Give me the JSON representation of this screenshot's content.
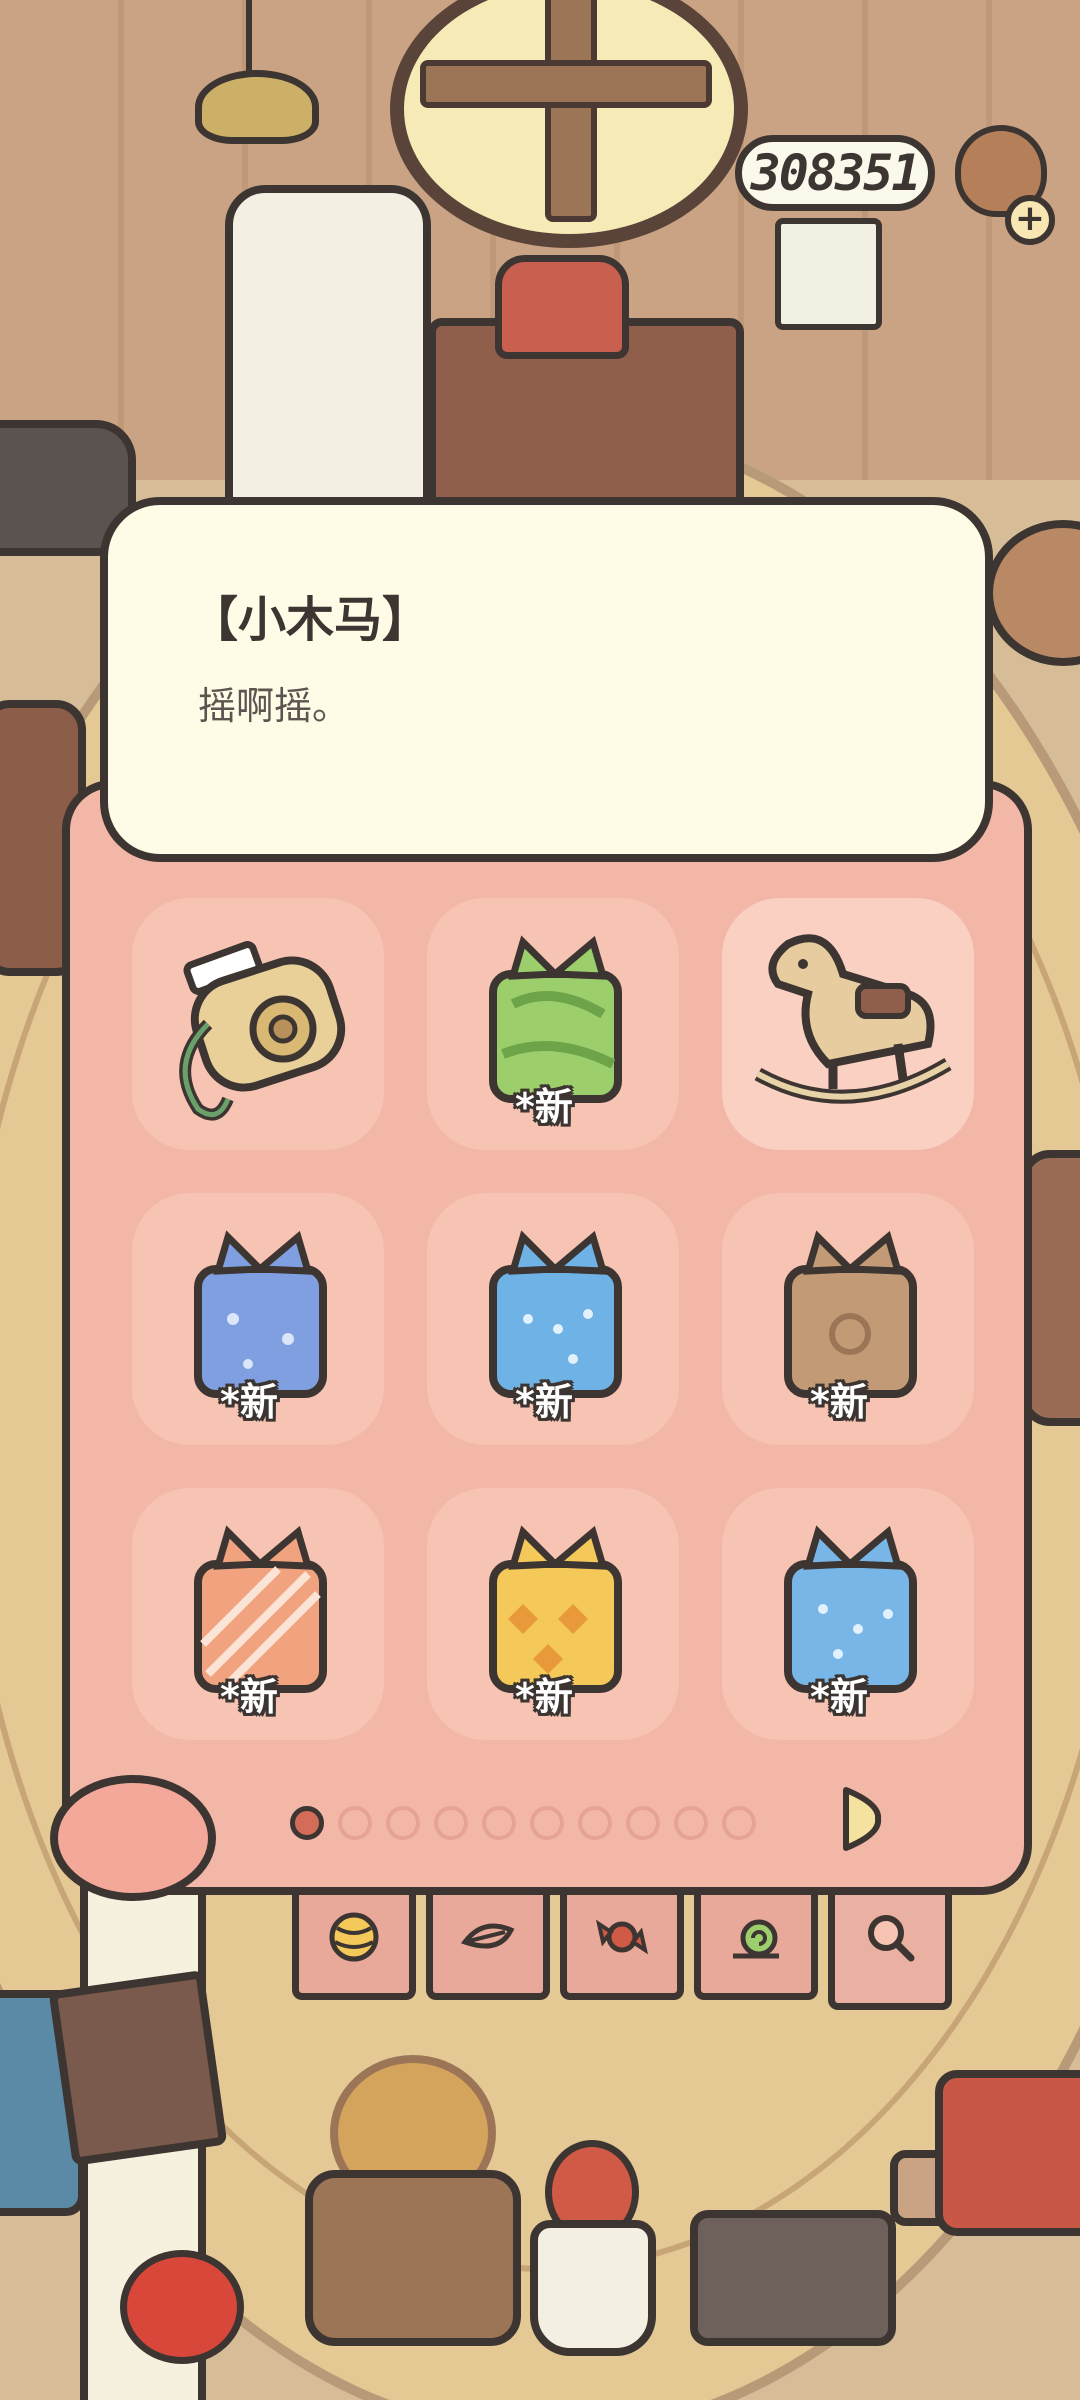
{
  "currency": {
    "amount": "308351",
    "add_icon": "plus-icon"
  },
  "item_info": {
    "title": "【小木马】",
    "description": "摇啊摇。"
  },
  "items": [
    {
      "name": "instant-camera",
      "icon": "camera-icon",
      "new_label": ""
    },
    {
      "name": "gift-green",
      "icon": "gift-icon",
      "color": "#9ccf6c",
      "new_label": "*新"
    },
    {
      "name": "rocking-horse",
      "icon": "rocking-horse-icon",
      "new_label": "",
      "selected": true
    },
    {
      "name": "gift-blue-star",
      "icon": "gift-icon",
      "color": "#7f9fe0",
      "new_label": "*新"
    },
    {
      "name": "gift-blue-dots",
      "icon": "gift-icon",
      "color": "#6fb2e6",
      "new_label": "*新"
    },
    {
      "name": "gift-brown",
      "icon": "gift-icon",
      "color": "#c29a76",
      "new_label": "*新"
    },
    {
      "name": "gift-orange-stripe",
      "icon": "gift-icon",
      "color": "#f1a37f",
      "new_label": "*新"
    },
    {
      "name": "gift-yellow-check",
      "icon": "gift-icon",
      "color": "#f4c95a",
      "new_label": "*新"
    },
    {
      "name": "gift-blue-dots-2",
      "icon": "gift-icon",
      "color": "#79b6e8",
      "new_label": "*新"
    }
  ],
  "pagination": {
    "total_pages": 10,
    "current_page": 1,
    "next_icon": "next-arrow-icon"
  },
  "tabs": [
    {
      "name": "yarn-ball",
      "icon": "yarn-ball-icon"
    },
    {
      "name": "leaf",
      "icon": "leaf-icon"
    },
    {
      "name": "candy",
      "icon": "candy-icon"
    },
    {
      "name": "snail",
      "icon": "snail-icon"
    },
    {
      "name": "search",
      "icon": "search-icon"
    }
  ],
  "colors": {
    "panel": "#f2b7a7",
    "slot": "#f7c3b3",
    "card": "#fefbe6",
    "outline": "#3d3531"
  }
}
